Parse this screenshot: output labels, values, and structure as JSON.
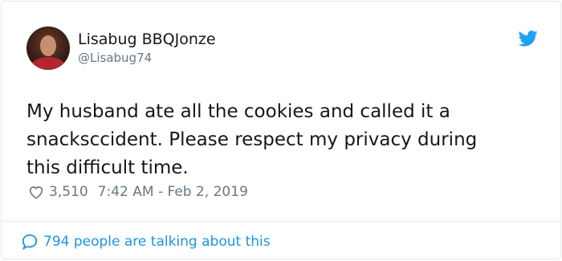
{
  "author": {
    "name": "Lisabug BBQJonze",
    "handle": "@Lisabug74",
    "avatar_icon": "profile-photo"
  },
  "tweet": {
    "lines": [
      "My husband ate all the cookies and called it a",
      "snacksccident. Please respect my privacy during",
      "this difficult time."
    ]
  },
  "meta": {
    "likes": "3,510",
    "timestamp": "7:42 AM - Feb 2, 2019",
    "like_icon": "heart-icon"
  },
  "footer": {
    "conversation_text": "794 people are talking about this",
    "icon": "speech-bubble-icon"
  },
  "colors": {
    "brand": "#1da1f2",
    "link": "#1b95e0",
    "text": "#14171a",
    "muted": "#657786",
    "border": "#e1e8ed"
  },
  "logo_icon": "twitter-bird-icon"
}
